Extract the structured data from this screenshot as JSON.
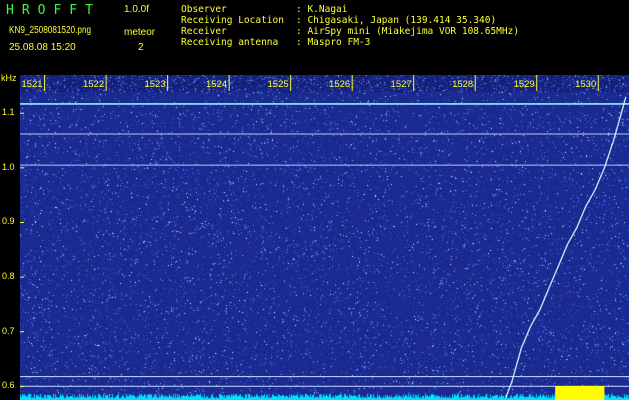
{
  "header": {
    "app_title": "HROFFT",
    "version": "1.0.0f",
    "filename": "KN9_2508081520.png",
    "meteor_label": "meteor",
    "datetime": "25.08.08 15:20",
    "meteor_count": "2"
  },
  "info": [
    {
      "label": "Observer",
      "value": ": K.Nagai"
    },
    {
      "label": "Receiving Location",
      "value": ": Chigasaki, Japan (139.414 35.340)"
    },
    {
      "label": "Receiver",
      "value": ": AirSpy mini (Miakejima VOR 108.65MHz)"
    },
    {
      "label": "Receiving antenna",
      "value": ": Maspro FM-3"
    }
  ],
  "colors": {
    "background": "#000000",
    "text": "#ffff33",
    "title": "#33ff33",
    "waterfall_base": "#1a2a90",
    "signal": "#e0ffff",
    "baseline": "#00e0ff"
  },
  "chart_data": {
    "type": "heatmap",
    "ylabel": "kHz",
    "y_ticks": [
      "1.1",
      "1.0",
      "0.9",
      "0.8",
      "0.7",
      "0.6"
    ],
    "y_tick_values": [
      1.1,
      1.0,
      0.9,
      0.8,
      0.7,
      0.6
    ],
    "x_ticks": [
      "1521",
      "1522",
      "1523",
      "1524",
      "1525",
      "1526",
      "1527",
      "1528",
      "1529",
      "1530"
    ],
    "x_tick_values": [
      1521,
      1522,
      1523,
      1524,
      1525,
      1526,
      1527,
      1528,
      1529,
      1530
    ],
    "xlim": [
      1520.6,
      1530.5
    ],
    "ylim": [
      0.575,
      1.17
    ],
    "carrier_lines_khz": [
      1.117,
      1.062,
      1.005,
      0.618,
      0.6
    ],
    "meteor_trail": {
      "x": [
        1528.5,
        1528.6,
        1528.75,
        1528.9,
        1529.05,
        1529.2,
        1529.35,
        1529.5,
        1529.65,
        1529.8,
        1529.95,
        1530.1,
        1530.25,
        1530.45
      ],
      "y": [
        0.58,
        0.61,
        0.67,
        0.71,
        0.74,
        0.78,
        0.82,
        0.86,
        0.89,
        0.93,
        0.96,
        1.0,
        1.05,
        1.13
      ]
    }
  }
}
